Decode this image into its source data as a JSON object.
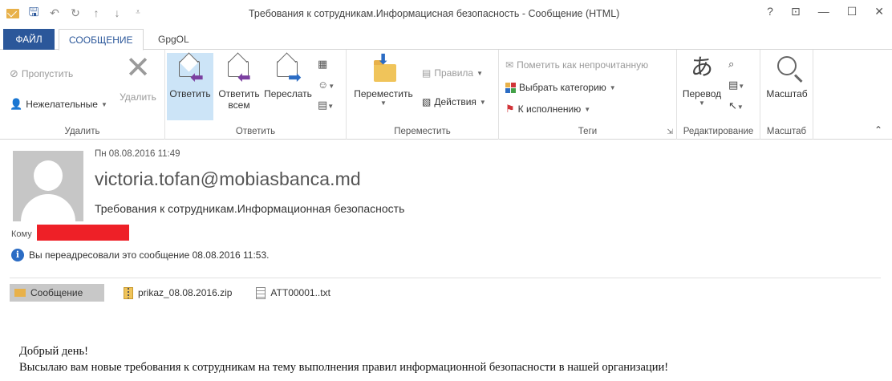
{
  "window": {
    "title": "Требования к сотрудникам.Информацисная безопасность - Сообщение (HTML)",
    "controls": [
      "?",
      "⊡",
      "—",
      "☐",
      "✕"
    ]
  },
  "qat": {
    "icons": [
      "mail-icon",
      "save-icon",
      "undo-icon",
      "redo-icon",
      "up-icon",
      "down-icon",
      "customize-icon"
    ]
  },
  "tabs": [
    {
      "label": "ФАЙЛ"
    },
    {
      "label": "СООБЩЕНИЕ"
    },
    {
      "label": "GpgOL"
    }
  ],
  "ribbon": {
    "delete_group": {
      "label": "Удалить",
      "ignore": "Пропустить",
      "junk": "Нежелательные",
      "delete": "Удалить"
    },
    "respond_group": {
      "label": "Ответить",
      "reply": "Ответить",
      "reply_all_1": "Ответить",
      "reply_all_2": "всем",
      "forward": "Переслать"
    },
    "move_group": {
      "label": "Переместить",
      "move": "Переместить",
      "rules": "Правила",
      "actions": "Действия"
    },
    "tags_group": {
      "label": "Теги",
      "mark_unread": "Пометить как непрочитанную",
      "categorize": "Выбрать категорию",
      "follow_up": "К исполнению"
    },
    "edit_group": {
      "label": "Редактирование",
      "translate": "Перевод"
    },
    "zoom_group": {
      "label": "Масштаб",
      "zoom": "Масштаб"
    }
  },
  "message": {
    "date": "Пн 08.08.2016 11:49",
    "sender": "victoria.tofan@mobiasbanca.md",
    "subject": "Требования к сотрудникам.Информационная безопасность",
    "to_label": "Кому",
    "info": "Вы переадресовали это сообщение 08.08.2016 11:53.",
    "attachments": [
      {
        "name": "Сообщение"
      },
      {
        "name": "prikaz_08.08.2016.zip"
      },
      {
        "name": "ATT00001..txt"
      }
    ],
    "body_line1": "Добрый день!",
    "body_line2": "Высылаю вам новые требования к сотрудникам на тему выполнения правил информационной безопасности в нашей организации!"
  },
  "colors": {
    "accent": "#2b579a",
    "active_button": "#cce4f7",
    "redaction": "#ee2027"
  }
}
